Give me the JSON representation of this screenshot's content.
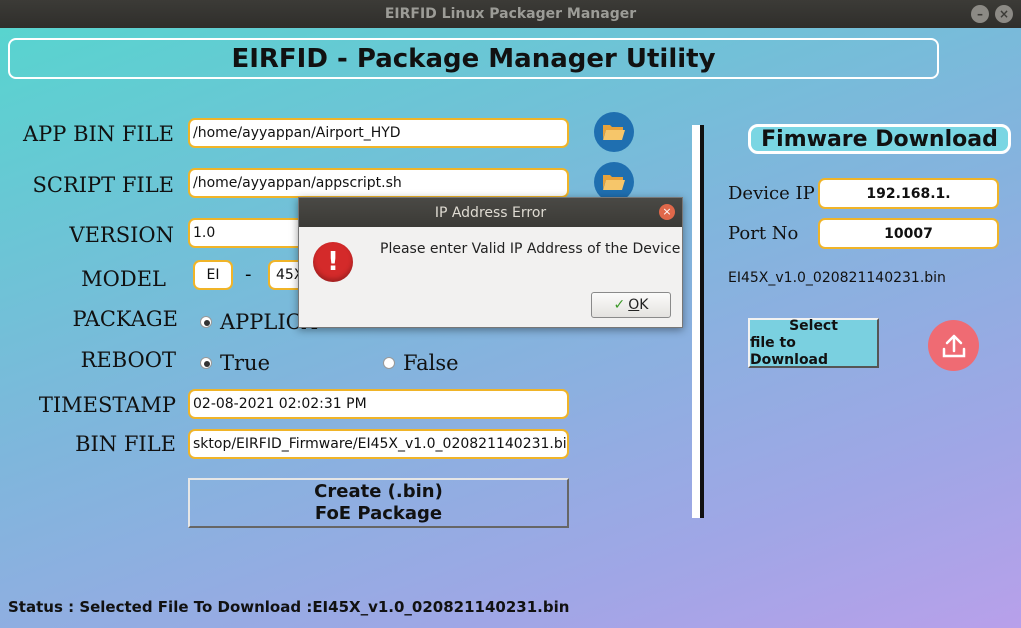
{
  "window": {
    "title": "EIRFID Linux Packager Manager",
    "minimize": "–",
    "close": "×"
  },
  "banner": {
    "title": "EIRFID - Package Manager Utility"
  },
  "form": {
    "app_bin_label": "APP BIN FILE",
    "app_bin_value": "/home/ayyappan/Airport_HYD",
    "script_label": "SCRIPT FILE",
    "script_value": "/home/ayyappan/appscript.sh",
    "version_label": "VERSION",
    "version_value": "1.0",
    "model_label": "MODEL",
    "model_prefix": "EI",
    "model_dash": "-",
    "model_suffix": "45X",
    "package_label": "PACKAGE",
    "package_option": "APPLICA",
    "reboot_label": "REBOOT",
    "reboot_true": "True",
    "reboot_false": "False",
    "timestamp_label": "TIMESTAMP",
    "timestamp_value": "02-08-2021 02:02:31 PM",
    "bin_file_label": "BIN FILE",
    "bin_file_value": "sktop/EIRFID_Firmware/EI45X_v1.0_020821140231.bin",
    "create_line1": "Create (.bin)",
    "create_line2": "FoE Package"
  },
  "firmware": {
    "title": "Fimware Download",
    "device_ip_label": "Device IP",
    "device_ip_value": "192.168.1.",
    "port_label": "Port No",
    "port_value": "10007",
    "selected_file": "EI45X_v1.0_020821140231.bin",
    "select_line1": "Select",
    "select_line2": "file to Download"
  },
  "status": {
    "text": "Status : Selected File To Download :EI45X_v1.0_020821140231.bin"
  },
  "dialog": {
    "title": "IP Address Error",
    "close": "×",
    "icon_glyph": "!",
    "message": "Please enter Valid IP Address of the Device",
    "ok_rest": "K",
    "ok_mnemonic": "O",
    "ok_check": "✓"
  },
  "colors": {
    "field_border": "#f0b428",
    "upload": "#ef6b73",
    "folder": "#1f6fb0"
  }
}
